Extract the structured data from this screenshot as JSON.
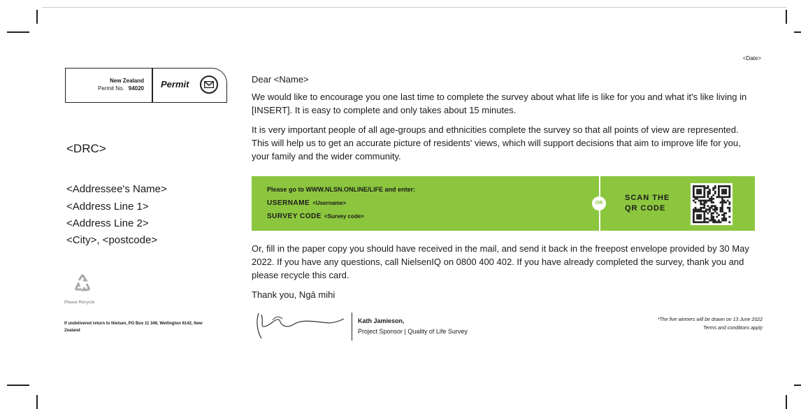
{
  "permit": {
    "country": "New Zealand",
    "permit_no_label": "Permit No.",
    "permit_no": "94020",
    "label": "Permit"
  },
  "recipient": {
    "drc": "<DRC>",
    "name": "<Addressee's Name>",
    "line1": "<Address Line 1>",
    "line2": "<Address Line 2>",
    "city": "<City>, <postcode>"
  },
  "recycle_label": "Please Recycle",
  "undeliverable": "If undelivered return to Nielsen, PO Box 11 346, Wellington 6142, New Zealand",
  "date": "<Date>",
  "greeting": "Dear <Name>",
  "para1": "We would like to encourage you one last time to complete the survey about what life is like for you and what it's like living in [INSERT]. It is easy to complete and only takes about 15 minutes.",
  "para2": "It is very important people of all age-groups and ethnicities complete the survey so that all points of view are represented. This will help us to get an accurate picture of residents' views, which will support decisions that aim to improve life for you, your family and the wider community.",
  "cta": {
    "instruction": "Please go to WWW.NLSN.ONLINE/LIFE and enter:",
    "username_label": "USERNAME",
    "username_value": "<Username>",
    "code_label": "SURVEY CODE",
    "code_value": "<Survey code>",
    "or": "OR",
    "scan_line1": "SCAN THE",
    "scan_line2": "QR CODE"
  },
  "para3": "Or, fill in the paper copy you should have received in the mail, and send it back in the freepost envelope provided by 30 May 2022. If you have any questions, call NielsenIQ on 0800 400 402. If you have already completed the survey, thank you and please recycle this card.",
  "signoff": "Thank you, Ngā mihi",
  "signatory": {
    "name": "Kath Jamieson,",
    "title": "Project Sponsor | Quality of Life Survey"
  },
  "draw_note": {
    "line1": "*The five winners will be drawn on 13 June 2022",
    "line2": "Terms and conditions apply"
  },
  "colors": {
    "accent_green": "#8cc63f"
  }
}
